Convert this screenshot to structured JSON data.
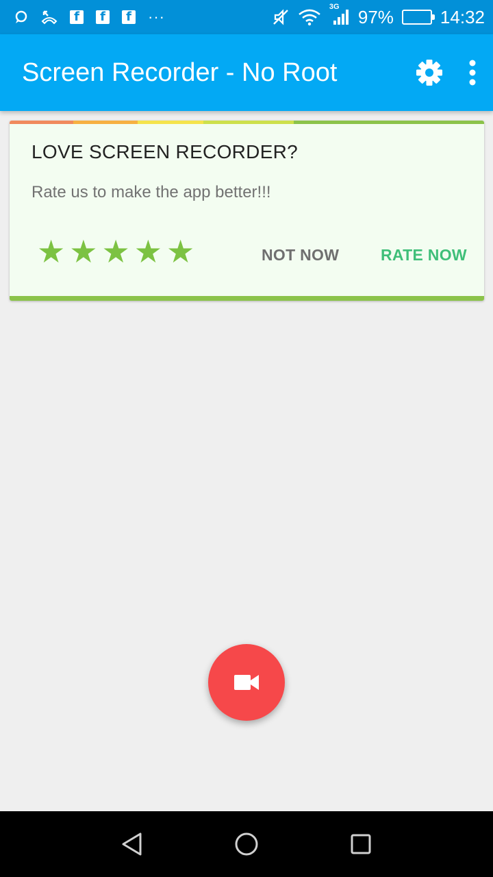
{
  "status_bar": {
    "battery_percent": "97%",
    "battery_level": 0.97,
    "time": "14:32",
    "network": "3G",
    "overflow": "···",
    "fb_letter": "f"
  },
  "app_bar": {
    "title": "Screen Recorder - No Root",
    "color": "#03a9f4"
  },
  "rate_card": {
    "title": "LOVE SCREEN RECORDER?",
    "subtitle": "Rate us to make the app better!!!",
    "stars": [
      "★",
      "★",
      "★",
      "★",
      "★"
    ],
    "rating": 5,
    "not_now_label": "NOT NOW",
    "rate_now_label": "RATE NOW",
    "rainbow_colors": [
      "#f08a5d",
      "#f6b042",
      "#f4e34c",
      "#cde04c",
      "#8bc34a"
    ],
    "star_color": "#7cc242"
  },
  "fab": {
    "icon": "videocam-icon",
    "color": "#f6484a"
  },
  "nav_bar": {
    "back_icon": "back-triangle-icon",
    "home_icon": "home-circle-icon",
    "recents_icon": "recents-square-icon"
  }
}
